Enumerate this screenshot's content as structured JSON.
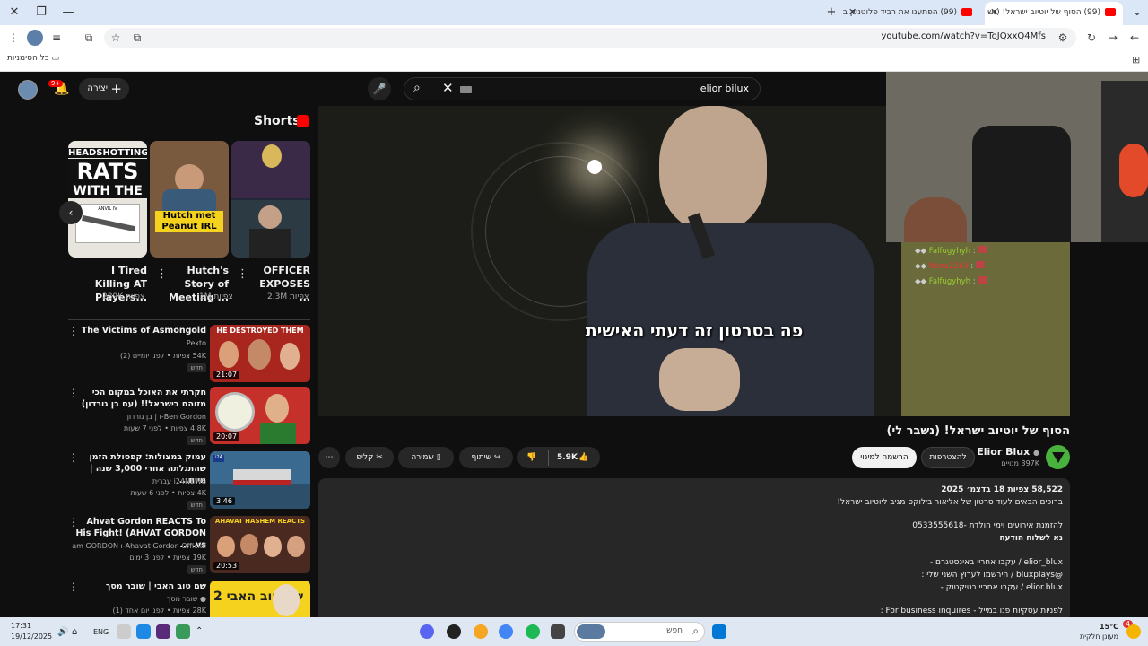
{
  "browser": {
    "tabs": [
      {
        "title": "(99) הסוף של יוטיוב ישראל! (נש",
        "active": true
      },
      {
        "title": "(99) הפתענו את רביד פלוטניק ב",
        "active": false
      }
    ],
    "url": "youtube.com/watch?v=ToJQxxQ4Mfs",
    "bookmarks_label": "כל הסימניות"
  },
  "header": {
    "create_label": "יצירה",
    "notifications": "9+",
    "search_query": "elior bilux"
  },
  "shorts": {
    "heading": "Shorts",
    "items": [
      {
        "thumb_text1": "HEADSHOTTING",
        "thumb_text2": "RATS",
        "thumb_text3": "WITH THE",
        "thumb_text4": "ANVIL IV",
        "title": "I Tired Killing AT Players...",
        "views": "289K צפיות"
      },
      {
        "thumb_text1": "Hutch met",
        "thumb_text2": "Peanut IRL",
        "title": "Hutch's Story of Meeting ...",
        "views": "1M צפיות"
      },
      {
        "title": "OFFICER EXPOSES ...",
        "views": "2.3M צפיות"
      }
    ]
  },
  "related": [
    {
      "title": "The Victims of Asmongold",
      "channel": "Pexto",
      "meta": "54K צפיות • לפני יומיים (2)",
      "new_label": "חדש",
      "duration": "21:07",
      "thumb_text": "HE DESTROYED THEM"
    },
    {
      "title": "חקרתי את האוכל במקום הכי מזוהם בישראל!! (עם בן גורדון)",
      "channel": "Ben Gordon-ו | בן גורדון",
      "meta": "4.8K צפיות • לפני 7 שעות",
      "new_label": "חדש",
      "duration": "20:07"
    },
    {
      "title": "עמוק במצולות: קפסולת הזמן שהתגלתה אחרי 3,000 שנה | מיוח...",
      "channel": "i24NEWS עברית",
      "meta": "4K צפיות • לפני 6 שעות",
      "new_label": "חדש",
      "duration": "3:46"
    },
    {
      "title": "Ahvat Gordon REACTS To His Fight! (AHVAT GORDON vs. ...",
      "channel": "Ahavat Gordon Official-ו Team GORDON |...",
      "meta": "19K צפיות • לפני 3 ימים",
      "new_label": "חדש",
      "duration": "20:53",
      "thumb_text": "AHAVAT HASHEM REACTS"
    },
    {
      "title": "שם טוב האבי | שובר מסך",
      "channel": "שובר מסך",
      "meta": "28K צפיות • לפני יום אחד (1)",
      "new_label": "",
      "duration": "",
      "thumb_text": "שם טוב האבי 2"
    }
  ],
  "player": {
    "subtitle": "פה בסרטון זה דעתי האישית"
  },
  "chat": [
    {
      "name": "Falfugyhyh",
      "color": "#9acd32"
    },
    {
      "name": "Nena2243",
      "color": "#e33"
    },
    {
      "name": "Falfugyhyh",
      "color": "#9acd32"
    }
  ],
  "video": {
    "title": "הסוף של יוטיוב ישראל! (נשבר לי)",
    "channel": "Elior Blux",
    "subscribers": "397K מנויים",
    "join_label": "להצטרפות",
    "subscribe_label": "הרשמה למינוי",
    "likes": "5.9K",
    "share_label": "שיתוף",
    "save_label": "שמירה",
    "clip_label": "קליפ",
    "more_icon": "more-icon"
  },
  "description": {
    "stats": "58,522 צפיות  18 בדצמ׳ 2025",
    "lines": [
      "ברוכים הבאים לעוד סרטון של אליאור בילוקס מגיב ליוטיוב ישראל!",
      "להזמנת אירועים וימי הולדת -0533555618",
      "נא לשלוח הודעה",
      "elior_blux / עקבו אחריי באינסטגרם -",
      "@bluxplays / הירשמו לערוץ השני שלי :",
      "elior.blux / עקבו אחריי בטיקטוק -",
      "לפניות עסקיות פנו במייל - For business inquires :"
    ]
  },
  "taskbar": {
    "time": "17:31",
    "date": "19/12/2025",
    "lang": "ENG",
    "search_placeholder": "חפש",
    "weather_temp": "15°C",
    "weather_desc": "מעונן חלקית",
    "notif_count": "4"
  }
}
